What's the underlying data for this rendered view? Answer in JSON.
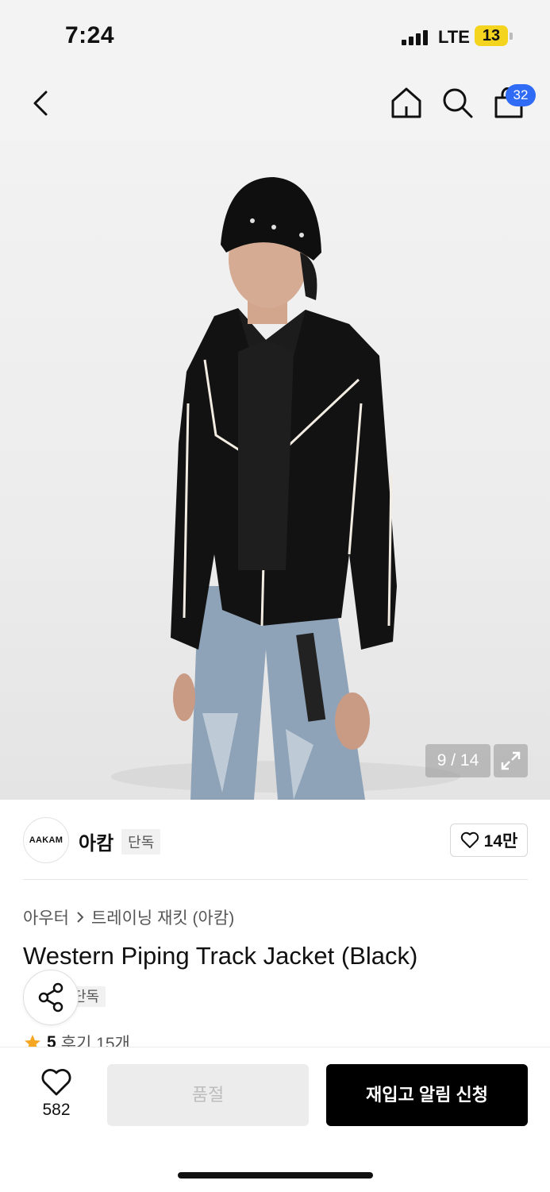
{
  "status_bar": {
    "time": "7:24",
    "network": "LTE",
    "battery": "13"
  },
  "nav": {
    "cart_count": "32",
    "icons": [
      "back-icon",
      "home-icon",
      "search-icon",
      "cart-icon"
    ]
  },
  "gallery": {
    "counter": "9 / 14"
  },
  "brand": {
    "logo_text": "AAKAM",
    "name": "아캄",
    "tag": "단독",
    "likes": "14만"
  },
  "product": {
    "breadcrumb": [
      "아우터",
      "트레이닝 재킷 (아캄)"
    ],
    "title": "Western Piping Track Jacket (Black)",
    "tag": "단독",
    "rating": "5",
    "reviews": "후기 15개"
  },
  "bottom_bar": {
    "wish_count": "582",
    "soldout_label": "품절",
    "restock_label": "재입고 알림 신청"
  },
  "colors": {
    "badge": "#2f6bf4",
    "star": "#f5a623",
    "primary_button": "#000000",
    "disabled_button": "#ececec"
  }
}
